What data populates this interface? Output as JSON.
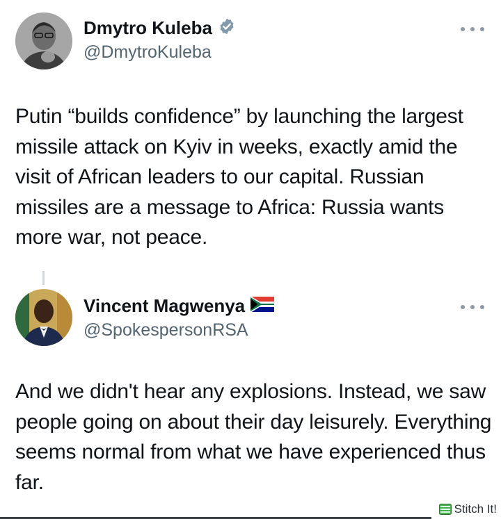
{
  "tweets": [
    {
      "display_name": "Dmytro Kuleba",
      "verified_icon": "verified-badge-icon",
      "handle": "@DmytroKuleba",
      "text": "Putin “builds confidence” by launching the largest missile attack on Kyiv in weeks, exactly amid the visit of African leaders to our capital. Russian missiles are a message to Africa: Russia wants more war, not peace."
    },
    {
      "display_name": "Vincent Magwenya",
      "flag_icon": "south-africa-flag-icon",
      "handle": "@SpokespersonRSA",
      "text": "And we didn't hear any explosions. Instead, we saw people going on about their day leisurely. Everything seems normal from what we have experienced thus far."
    }
  ],
  "watermark": {
    "label": "Stitch It!"
  },
  "colors": {
    "text_primary": "#0f1419",
    "text_secondary": "#536471",
    "verified_badge": "#829aab"
  }
}
